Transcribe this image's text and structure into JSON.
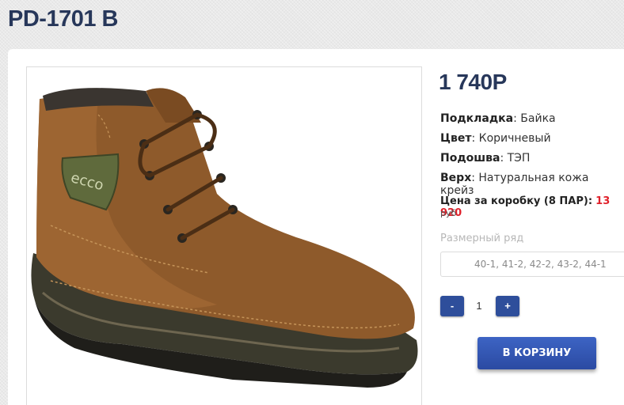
{
  "product": {
    "title": "PD-1701 B",
    "price": "1 740Р",
    "specs": [
      {
        "label": "Подкладка",
        "value": "Байка"
      },
      {
        "label": "Цвет",
        "value": "Коричневый"
      },
      {
        "label": "Подошва",
        "value": "ТЭП"
      },
      {
        "label": "Верх",
        "value": "Натуральная кожа крейз"
      }
    ],
    "box_price_label": "Цена за коробку (8 ПАР):",
    "box_price_value": "13 920",
    "currency": "руб",
    "size_label": "Размерный ряд",
    "size_value": "40-1, 41-2, 42-2, 43-2, 44-1",
    "image_icon": "brown-leather-boot-photo",
    "image_logo_text": "ecco"
  },
  "quantity": {
    "minus_label": "-",
    "value": "1",
    "plus_label": "+"
  },
  "cart_button_label": "В КОРЗИНУ",
  "colors": {
    "title": "#27375a",
    "accent": "#2e4e9b",
    "price_red": "#e0212b"
  }
}
